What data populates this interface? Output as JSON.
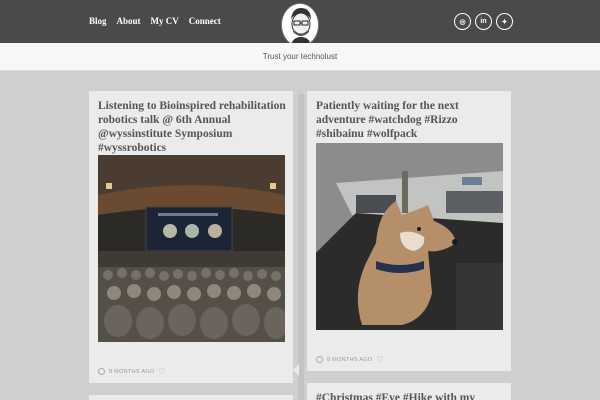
{
  "nav": [
    "Blog",
    "About",
    "My CV",
    "Connect"
  ],
  "social": [
    "instagram-icon",
    "linkedin-icon",
    "twitter-icon"
  ],
  "social_labels": [
    "◎",
    "in",
    "✦"
  ],
  "tagline": "Trust your technolust",
  "posts": [
    {
      "title": "Listening to Bioinspired rehabilitation robotics talk @ 6th Annual @wyssinstitute Symposium #wyssrobotics",
      "time": "8 MONTHS AGO"
    },
    {
      "title": "Patiently waiting for the next adventure #watchdog #Rizzo #shibainu #wolfpack",
      "time": "8 MONTHS AGO"
    },
    {
      "title": "#Christmas #Eve #Hike with my"
    }
  ]
}
